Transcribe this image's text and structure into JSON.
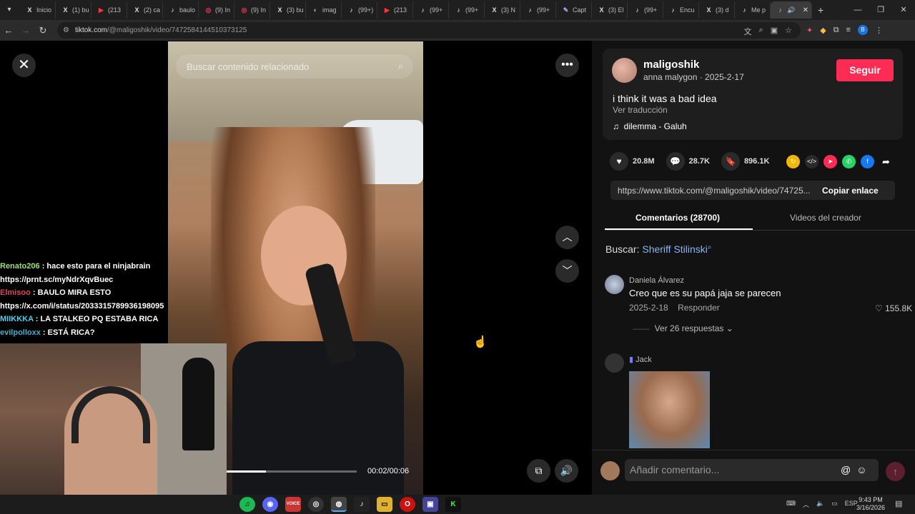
{
  "browser": {
    "tabs": [
      {
        "icon": "x-logo",
        "label": "Inicio"
      },
      {
        "icon": "x-logo",
        "label": "(1) bu"
      },
      {
        "icon": "youtube-logo",
        "label": "(213"
      },
      {
        "icon": "x-logo",
        "label": "(2) ca"
      },
      {
        "icon": "tiktok-logo",
        "label": "baulo"
      },
      {
        "icon": "instagram-logo",
        "label": "(9) In"
      },
      {
        "icon": "instagram-logo",
        "label": "(9) In"
      },
      {
        "icon": "x-logo",
        "label": "(3) bu"
      },
      {
        "icon": "image-logo",
        "label": "imag"
      },
      {
        "icon": "tiktok-logo",
        "label": "(99+)"
      },
      {
        "icon": "youtube-logo",
        "label": "(213"
      },
      {
        "icon": "tiktok-logo",
        "label": "(99+"
      },
      {
        "icon": "tiktok-logo",
        "label": "(99+"
      },
      {
        "icon": "x-logo",
        "label": "(3) N"
      },
      {
        "icon": "tiktok-logo",
        "label": "(99+"
      },
      {
        "icon": "pen-logo",
        "label": "Capt"
      },
      {
        "icon": "x-logo",
        "label": "(3) El"
      },
      {
        "icon": "tiktok-logo",
        "label": "(99+"
      },
      {
        "icon": "tiktok-logo",
        "label": "Encu"
      },
      {
        "icon": "x-logo",
        "label": "(3) d"
      },
      {
        "icon": "tiktok-logo",
        "label": "Me p"
      }
    ],
    "active_tab_icon": "tiktok-logo",
    "url_host": "tiktok.com",
    "url_path": "/@maligoshik/video/7472584144510373125"
  },
  "video": {
    "search_placeholder": "Buscar contenido relacionado",
    "time": "00:02/00:06",
    "progress": 0.3
  },
  "chat": [
    {
      "user": "Renato206",
      "text": ": hace esto para el ninjabrain"
    },
    {
      "user": "",
      "text": "https://prnt.sc/myNdrXqvBuec"
    },
    {
      "user": "Elmisoo",
      "text": ": BAULO MIRA ESTO"
    },
    {
      "user": "",
      "text": "https://x.com/i/status/2033315789936198095"
    },
    {
      "user": "MIIKKKA",
      "text": ": LA STALKEO PQ ESTABA RICA"
    },
    {
      "user": "evilpolloxx",
      "text": ": ESTÁ RICA?"
    }
  ],
  "post": {
    "username": "maligoshik",
    "meta": "anna malygon · 2025-2-17",
    "follow_label": "Seguir",
    "caption": "i think it was a bad idea",
    "translate_label": "Ver traducción",
    "music": "dilemma - Galuh",
    "likes": "20.8M",
    "comments_count": "28.7K",
    "saves": "896.1K",
    "link": "https://www.tiktok.com/@maligoshik/video/74725...",
    "copy_label": "Copiar enlace"
  },
  "tabs": {
    "comments": "Comentarios (28700)",
    "creator_videos": "Videos del creador"
  },
  "search": {
    "prefix": "Buscar:",
    "query": "Sheriff Stilinski"
  },
  "comments": [
    {
      "name": "Daniela Álvarez",
      "text": "Creo que es su papá jaja se parecen",
      "date": "2025-2-18",
      "reply_label": "Responder",
      "likes": "155.8K",
      "replies_label": "Ver 26 respuestas"
    },
    {
      "name": "Jack"
    }
  ],
  "input": {
    "placeholder": "Añadir comentario..."
  },
  "taskbar": {
    "time": "9:43 PM",
    "date": "3/16/2026",
    "lang": "ESP"
  },
  "colors": {
    "accent": "#fe2c55",
    "link": "#8ab4f8"
  }
}
